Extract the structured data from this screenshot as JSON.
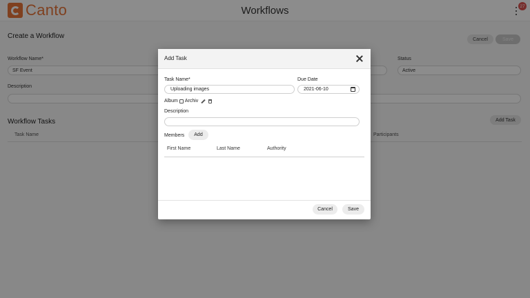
{
  "app": {
    "logo_text": "Canto",
    "title": "Workflows",
    "notification_count": "27"
  },
  "page": {
    "heading": "Create a Workflow",
    "cancel_label": "Cancel",
    "save_label": "Save",
    "workflow_name_label": "Workflow Name*",
    "workflow_name_value": "SF Event",
    "status_label": "Status",
    "status_value": "Active",
    "description_label": "Description",
    "description_value": "",
    "tasks_heading": "Workflow Tasks",
    "add_task_label": "Add Task",
    "columns": [
      "Task Name",
      "Participants"
    ]
  },
  "modal": {
    "title": "Add Task",
    "task_name_label": "Task Name*",
    "task_name_value": "Uploading images",
    "due_date_label": "Due Date",
    "due_date_value": "2021-06-10",
    "breadcrumb": {
      "album": "Album",
      "item": "Archiv"
    },
    "description_label": "Description",
    "description_value": "",
    "members_label": "Members",
    "add_label": "Add",
    "columns": [
      "First Name",
      "Last Name",
      "Authority"
    ],
    "cancel_label": "Cancel",
    "save_label": "Save"
  },
  "colors": {
    "brand": "#e8763a",
    "badge": "#d9534f",
    "overlay": "rgba(0,0,0,0.45)"
  }
}
